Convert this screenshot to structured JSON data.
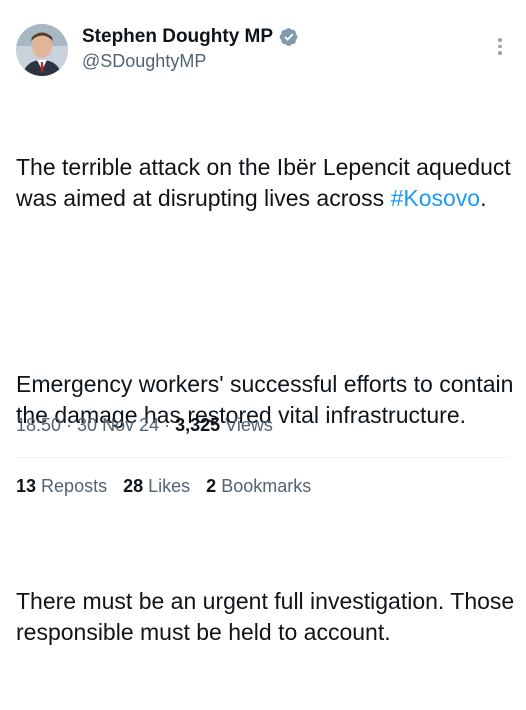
{
  "author": {
    "name": "Stephen Doughty MP",
    "handle": "@SDoughtyMP"
  },
  "tweet": {
    "line1": "The terrible attack on the Ibër Lepencit aqueduct was aimed at disrupting lives across ",
    "hashtag": "#Kosovo",
    "line1_end": ".",
    "para2": "Emergency workers' successful efforts to contain the damage has restored vital infrastructure.",
    "para3": "There must be an urgent full investigation. Those responsible must be held to account."
  },
  "meta": {
    "time": "18:50",
    "sep1": " · ",
    "date": "30 Nov 24",
    "sep2": " · ",
    "views_count": "3,325",
    "views_label": " Views"
  },
  "stats": {
    "reposts_count": "13",
    "reposts_label": "Reposts",
    "likes_count": "28",
    "likes_label": "Likes",
    "bookmarks_count": "2",
    "bookmarks_label": "Bookmarks"
  },
  "colors": {
    "hashtag": "#1d9bf0",
    "verified_badge": "#829aab",
    "secondary_text": "#536471"
  }
}
